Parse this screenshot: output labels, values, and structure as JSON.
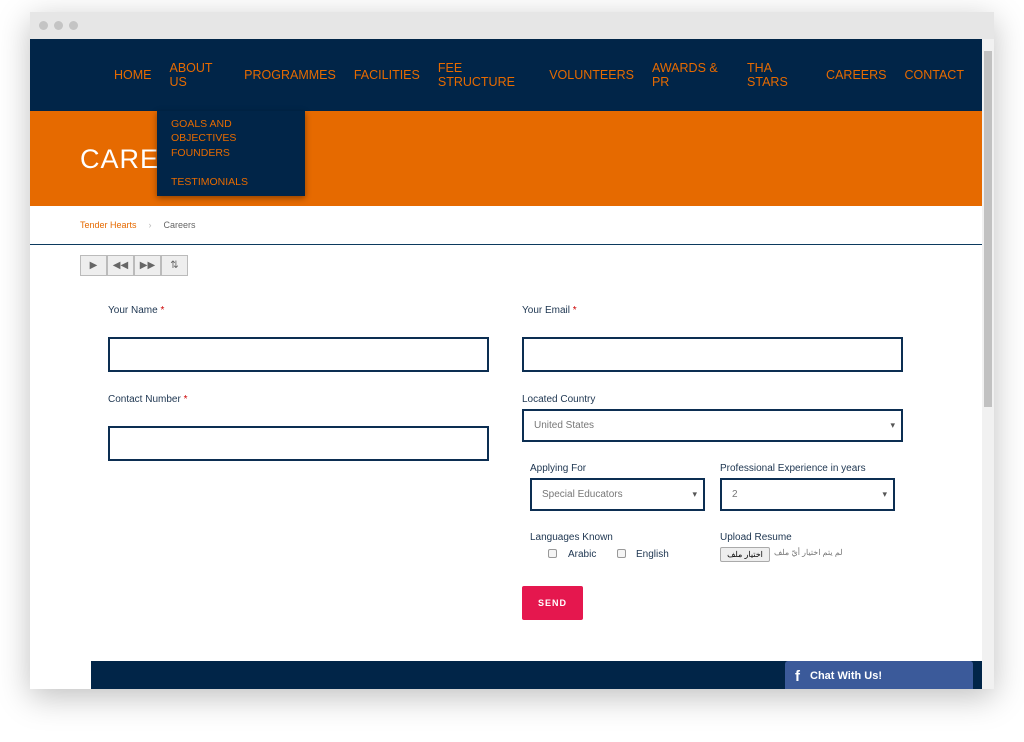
{
  "nav": {
    "items": [
      "HOME",
      "ABOUT US",
      "PROGRAMMES",
      "FACILITIES",
      "FEE STRUCTURE",
      "VOLUNTEERS",
      "AWARDS & PR",
      "THA STARS",
      "CAREERS",
      "CONTACT"
    ]
  },
  "dropdown": {
    "items": [
      "GOALS AND OBJECTIVES",
      "FOUNDERS",
      "TESTIMONIALS"
    ]
  },
  "banner": {
    "title": "CAREERS"
  },
  "breadcrumb": {
    "home": "Tender Hearts",
    "current": "Careers"
  },
  "media_controls": [
    "play-icon",
    "rewind-icon",
    "fast-forward-icon",
    "settings-icon"
  ],
  "form": {
    "name_label": "Your Name",
    "email_label": "Your Email",
    "contact_label": "Contact Number",
    "country_label": "Located Country",
    "country_value": "United States",
    "applying_label": "Applying For",
    "applying_value": "Special Educators",
    "experience_label": "Professional Experience in years",
    "experience_value": "2",
    "languages_label": "Languages Known",
    "lang1": "Arabic",
    "lang2": "English",
    "upload_label": "Upload Resume",
    "file_button": "اختيار ملف",
    "file_status": "لم يتم اختيار أيّ ملف",
    "required": "*",
    "send": "SEND"
  },
  "chat": {
    "label": "Chat With Us!"
  },
  "colors": {
    "navy": "#012548",
    "orange": "#e66a00",
    "send": "#e5174e",
    "facebook": "#3b5a9a"
  }
}
